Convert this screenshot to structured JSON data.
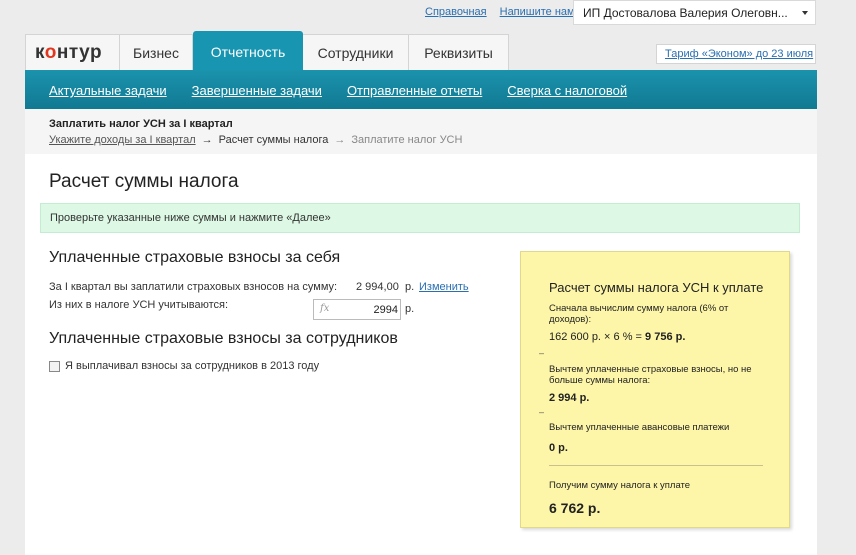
{
  "header": {
    "links": [
      "Справочная",
      "Напишите нам"
    ],
    "org_name": "ИП Достовалова Валерия Олеговн...",
    "tariff": "Тариф «Эконом» до 23 июля"
  },
  "logo": {
    "text_start": "к",
    "text_o": "о",
    "text_end": "нтур"
  },
  "main_tabs": [
    {
      "label": "Бизнес",
      "active": false
    },
    {
      "label": "Отчетность",
      "active": true
    },
    {
      "label": "Сотрудники",
      "active": false
    },
    {
      "label": "Реквизиты",
      "active": false
    }
  ],
  "sub_tabs": [
    "Актуальные задачи",
    "Завершенные задачи",
    "Отправленные отчеты",
    "Сверка с налоговой"
  ],
  "task": {
    "title": "Заплатить налог УСН за I квартал",
    "steps": [
      "Укажите доходы за I квартал",
      "Расчет суммы налога",
      "Заплатите налог УСН"
    ],
    "arrow": "→"
  },
  "page": {
    "title": "Расчет суммы налога",
    "notice": "Проверьте указанные ниже суммы и нажмите «Далее»"
  },
  "self_contrib": {
    "heading": "Уплаченные страховые взносы за себя",
    "paid_label": "За I квартал вы заплатили страховых взносов на сумму:",
    "paid_amount": "2 994,00",
    "currency": "р.",
    "change_link": "Изменить",
    "counted_label": "Из них в налоге УСН учитываются:",
    "counted_value": "2994",
    "fx": "fx"
  },
  "employee_contrib": {
    "heading": "Уплаченные страховые взносы за сотрудников",
    "checkbox_label": "Я выплачивал взносы за сотрудников в 2013 году",
    "checked": false
  },
  "calc": {
    "title": "Расчет суммы налога УСН к уплате",
    "step1_text": "Сначала вычислим сумму налога (6% от доходов):",
    "formula": "162 600 р. × 6 % =",
    "formula_result": "9 756 р.",
    "step2_text": "Вычтем уплаченные страховые взносы, но не больше суммы налога:",
    "step2_value": "2 994 р.",
    "step3_text": "Вычтем уплаченные авансовые платежи",
    "step3_value": "0 р.",
    "result_text": "Получим сумму налога к уплате",
    "result_value": "6 762 р.",
    "minus": "–"
  }
}
